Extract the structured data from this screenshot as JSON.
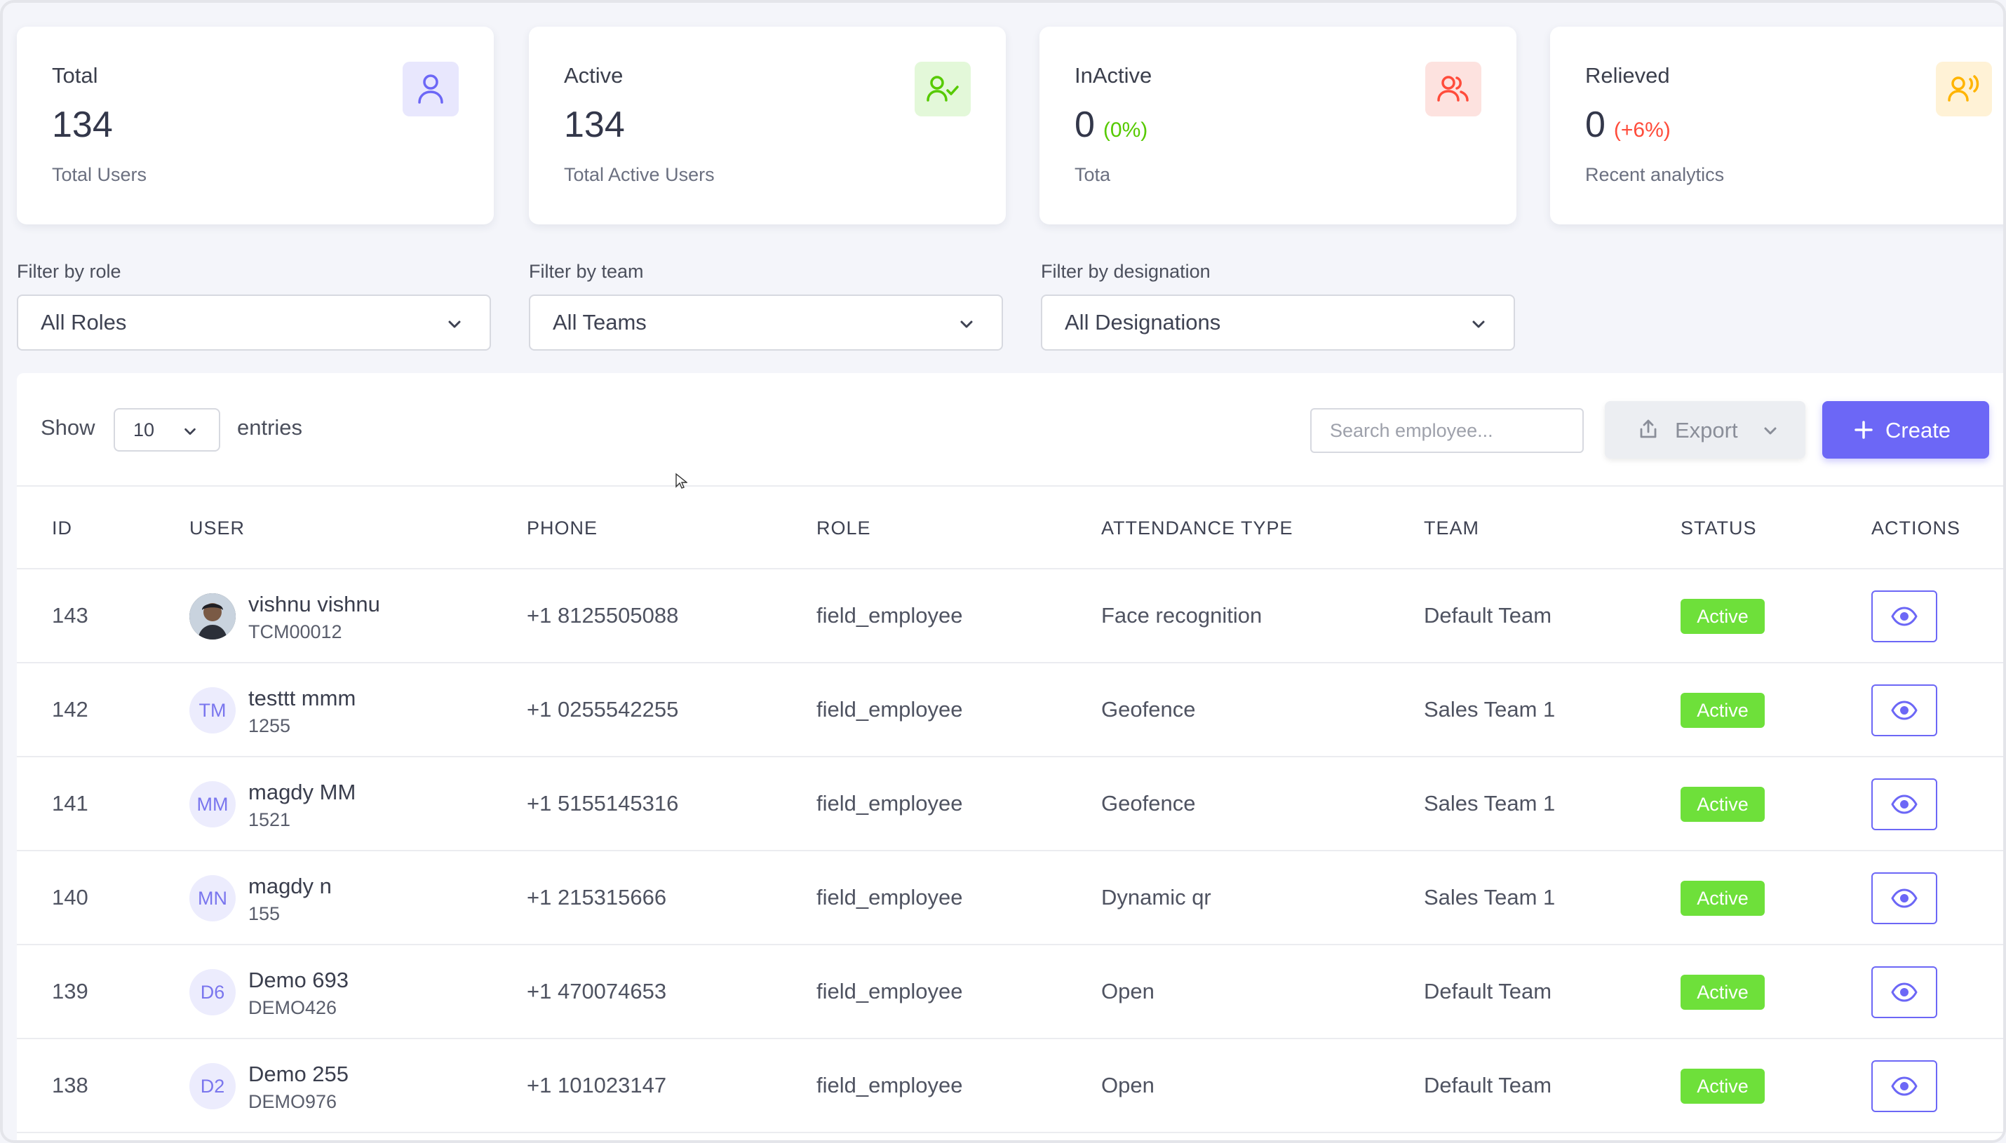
{
  "stats": [
    {
      "title": "Total",
      "value": "134",
      "pct": "",
      "pct_color": "",
      "subtitle": "Total Users",
      "icon": "user-icon",
      "icon_bg": "#e8e7fd",
      "icon_color": "#6c67f6"
    },
    {
      "title": "Active",
      "value": "134",
      "pct": "",
      "pct_color": "",
      "subtitle": "Total Active Users",
      "icon": "user-check-icon",
      "icon_bg": "#e3f8d9",
      "icon_color": "#56ca00"
    },
    {
      "title": "InActive",
      "value": "0",
      "pct": "(0%)",
      "pct_color": "#56ca00",
      "subtitle": "Tota",
      "icon": "users-icon",
      "icon_bg": "#fde2df",
      "icon_color": "#ff4c3b"
    },
    {
      "title": "Relieved",
      "value": "0",
      "pct": "(+6%)",
      "pct_color": "#ff4c3b",
      "subtitle": "Recent analytics",
      "icon": "user-voice-icon",
      "icon_bg": "#fff2d6",
      "icon_color": "#ffb400"
    }
  ],
  "filters": [
    {
      "label": "Filter by role",
      "value": "All Roles"
    },
    {
      "label": "Filter by team",
      "value": "All Teams"
    },
    {
      "label": "Filter by designation",
      "value": "All Designations"
    }
  ],
  "toolbar": {
    "show_label": "Show",
    "entries_value": "10",
    "entries_label": "entries",
    "search_placeholder": "Search employee...",
    "export_label": "Export",
    "create_label": "Create"
  },
  "columns": [
    "ID",
    "USER",
    "PHONE",
    "ROLE",
    "ATTENDANCE TYPE",
    "TEAM",
    "STATUS",
    "ACTIONS"
  ],
  "rows": [
    {
      "id": "143",
      "initials": "",
      "name": "vishnu vishnu",
      "code": "TCM00012",
      "phone": "+1 8125505088",
      "role": "field_employee",
      "attendance": "Face recognition",
      "team": "Default Team",
      "status": "Active"
    },
    {
      "id": "142",
      "initials": "TM",
      "name": "testtt mmm",
      "code": "1255",
      "phone": "+1 0255542255",
      "role": "field_employee",
      "attendance": "Geofence",
      "team": "Sales Team 1",
      "status": "Active"
    },
    {
      "id": "141",
      "initials": "MM",
      "name": "magdy MM",
      "code": "1521",
      "phone": "+1 5155145316",
      "role": "field_employee",
      "attendance": "Geofence",
      "team": "Sales Team 1",
      "status": "Active"
    },
    {
      "id": "140",
      "initials": "MN",
      "name": "magdy n",
      "code": "155",
      "phone": "+1 215315666",
      "role": "field_employee",
      "attendance": "Dynamic qr",
      "team": "Sales Team 1",
      "status": "Active"
    },
    {
      "id": "139",
      "initials": "D6",
      "name": "Demo 693",
      "code": "DEMO426",
      "phone": "+1 470074653",
      "role": "field_employee",
      "attendance": "Open",
      "team": "Default Team",
      "status": "Active"
    },
    {
      "id": "138",
      "initials": "D2",
      "name": "Demo 255",
      "code": "DEMO976",
      "phone": "+1 101023147",
      "role": "field_employee",
      "attendance": "Open",
      "team": "Default Team",
      "status": "Active"
    }
  ]
}
